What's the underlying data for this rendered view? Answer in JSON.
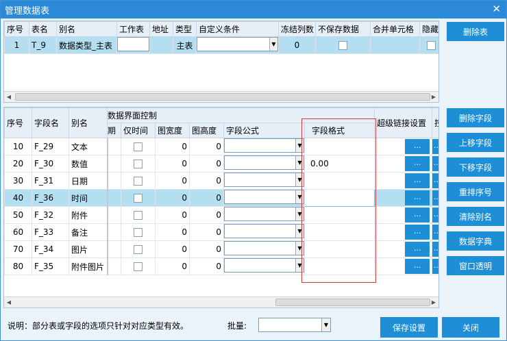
{
  "window": {
    "title": "管理数据表"
  },
  "table_grid": {
    "headers": [
      "序号",
      "表名",
      "别名",
      "工作表",
      "地址",
      "类型",
      "自定义条件",
      "冻结列数",
      "不保存数据",
      "合并单元格",
      "隐藏表"
    ],
    "rows": [
      {
        "seq": "1",
        "name": "T_9",
        "alias": "数据类型_主表",
        "type": "主表",
        "freeze": "0"
      }
    ]
  },
  "table_buttons": {
    "delete_table": "删除表"
  },
  "field_grid": {
    "group_header": "数据界面控制",
    "headers": {
      "seq": "序号",
      "field_name": "字段名",
      "alias": "别名",
      "date_partial": "期",
      "time_only": "仅时间",
      "img_width": "图宽度",
      "img_height": "图高度",
      "formula": "字段公式",
      "format": "字段格式",
      "hyperlink": "超级链接设置",
      "extra": "控"
    },
    "rows": [
      {
        "seq": "10",
        "field": "F_29",
        "alias": "文本",
        "w": "0",
        "h": "0",
        "format": ""
      },
      {
        "seq": "20",
        "field": "F_30",
        "alias": "数值",
        "w": "0",
        "h": "0",
        "format": "0.00"
      },
      {
        "seq": "30",
        "field": "F_31",
        "alias": "日期",
        "w": "0",
        "h": "0",
        "format": ""
      },
      {
        "seq": "40",
        "field": "F_36",
        "alias": "时间",
        "w": "0",
        "h": "0",
        "format": ""
      },
      {
        "seq": "50",
        "field": "F_32",
        "alias": "附件",
        "w": "0",
        "h": "0",
        "format": ""
      },
      {
        "seq": "60",
        "field": "F_33",
        "alias": "备注",
        "w": "0",
        "h": "0",
        "format": ""
      },
      {
        "seq": "70",
        "field": "F_34",
        "alias": "图片",
        "w": "0",
        "h": "0",
        "format": ""
      },
      {
        "seq": "80",
        "field": "F_35",
        "alias": "附件图片",
        "w": "0",
        "h": "0",
        "format": ""
      }
    ],
    "ellipsis": "..."
  },
  "field_buttons": {
    "delete_field": "删除字段",
    "move_up": "上移字段",
    "move_down": "下移字段",
    "renumber": "重排序号",
    "clear_alias": "清除别名",
    "dictionary": "数据字典",
    "transparent": "窗口透明"
  },
  "footer": {
    "note": "说明：部分表或字段的选项只针对对应类型有效。",
    "batch_label": "批量:",
    "save": "保存设置",
    "close": "关闭"
  },
  "colors": {
    "title_bar": "#2a8ad8",
    "button": "#1e8fd6",
    "selected_row": "#b3dff0",
    "highlight_box": "#d23a3a"
  },
  "icons": {
    "close": "close-icon",
    "dropdown": "chevron-down-icon"
  }
}
